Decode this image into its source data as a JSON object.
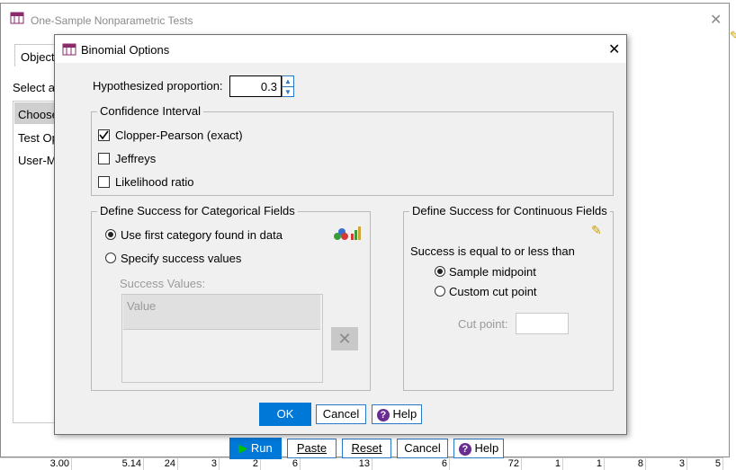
{
  "parent_dialog": {
    "title": "One-Sample Nonparametric Tests",
    "tab_objective": "Object",
    "select_label": "Select a",
    "left_items": [
      "Choose",
      "Test Op",
      "User-M"
    ],
    "buttons": {
      "run": "Run",
      "paste": "Paste",
      "reset": "Reset",
      "cancel": "Cancel",
      "help": "Help"
    }
  },
  "background_cells": [
    "3.00",
    "5.14",
    "24",
    "3",
    "2",
    "6",
    "13",
    "6",
    "72",
    "1",
    "1",
    "8",
    "3",
    "5"
  ],
  "dialog": {
    "title": "Binomial Options",
    "hypothesized_label": "Hypothesized proportion:",
    "hypothesized_value": "0.3",
    "ci_group": "Confidence Interval",
    "ci_options": [
      {
        "label": "Clopper-Pearson (exact)",
        "checked": true
      },
      {
        "label": "Jeffreys",
        "checked": false
      },
      {
        "label": "Likelihood ratio",
        "checked": false
      }
    ],
    "categorical_group": "Define Success for Categorical Fields",
    "cat_option_first": "Use first category found in data",
    "cat_option_specify": "Specify success values",
    "success_values_label": "Success Values:",
    "value_header": "Value",
    "continuous_group": "Define Success for Continuous Fields",
    "success_equal_label": "Success is equal to or less than",
    "cont_option_midpoint": "Sample midpoint",
    "cont_option_custom": "Custom cut point",
    "cut_point_label": "Cut point:",
    "cut_point_value": "",
    "ok": "OK",
    "cancel": "Cancel",
    "help": "Help"
  },
  "colors": {
    "accent": "#0078d7",
    "help_icon": "#6a2c91"
  }
}
